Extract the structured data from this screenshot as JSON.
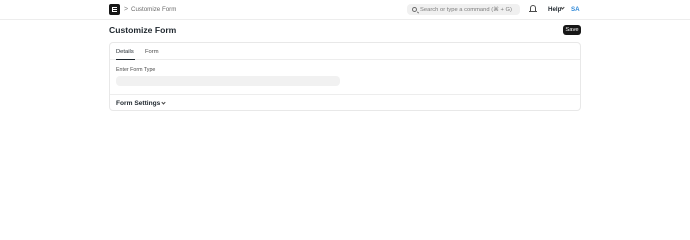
{
  "navbar": {
    "breadcrumb_separator": ">",
    "breadcrumb": "Customize Form",
    "search_placeholder": "Search or type a command (⌘ + G)",
    "help_label": "Help",
    "avatar_initials": "SA",
    "logo_icon": "frappe-logo-icon",
    "bell_icon": "bell-icon"
  },
  "page": {
    "title": "Customize Form",
    "save_label": "Save"
  },
  "tabs": [
    {
      "label": "Details",
      "active": true
    },
    {
      "label": "Form",
      "active": false
    }
  ],
  "form": {
    "field_label": "Enter Form Type",
    "field_value": ""
  },
  "section": {
    "title": "Form Settings"
  },
  "colors": {
    "accent": "#171717",
    "avatar": "#318ad8"
  }
}
